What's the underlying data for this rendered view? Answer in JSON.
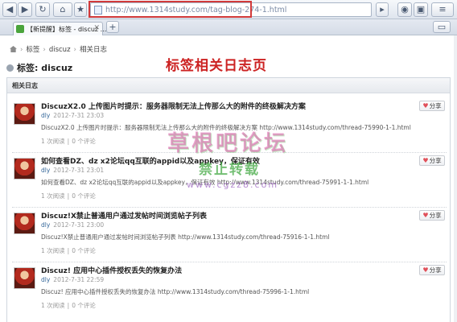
{
  "browser": {
    "back_icon": "arrow-left-icon",
    "forward_icon": "arrow-right-icon",
    "refresh_icon": "refresh-icon",
    "home_icon": "home-icon",
    "star_icon": "star-icon",
    "url": "http://www.1314study.com/tag-blog-274-1.html",
    "tab_title": "【新提醒】标签 - discuz ...",
    "new_tab_icon": "plus-icon"
  },
  "page": {
    "breadcrumb": [
      "标签",
      "discuz",
      "相关日志"
    ],
    "tag_title": "标签: discuz",
    "annotation": "标签相关日志页",
    "panel_title": "相关日志",
    "share_label": "分享",
    "posts": [
      {
        "title": "DiscuzX2.0 上传图片时提示：服务器限制无法上传那么大的附件的终极解决方案",
        "author": "dly",
        "date": "2012-7-31 23:03",
        "body": "DiscuzX2.0 上传图片时提示：服务器限制无法上传那么大的附件的终极解决方案 http://www.1314study.com/thread-75990-1-1.html",
        "views": "1 次阅读",
        "comments": "0 个评论"
      },
      {
        "title": "如何查看DZ、dz x2论坛qq互联的appid以及appkey，保证有效",
        "author": "dly",
        "date": "2012-7-31 23:01",
        "body": "如何查看DZ、dz x2论坛qq互联的appid以及appkey，保证有效 http://www.1314study.com/thread-75991-1-1.html",
        "views": "1 次阅读",
        "comments": "0 个评论"
      },
      {
        "title": "Discuz!X禁止普通用户通过发帖时间浏览帖子列表",
        "author": "dly",
        "date": "2012-7-31 23:00",
        "body": "Discuz!X禁止普通用户通过发帖时间浏览帖子列表 http://www.1314study.com/thread-75916-1-1.html",
        "views": "1 次阅读",
        "comments": "0 个评论"
      },
      {
        "title": "Discuz! 应用中心插件授权丢失的恢复办法",
        "author": "dly",
        "date": "2012-7-31 22:59",
        "body": "Discuz! 应用中心插件授权丢失的恢复办法 http://www.1314study.com/thread-75996-1-1.html",
        "views": "1 次阅读",
        "comments": "0 个评论"
      }
    ]
  },
  "watermark": {
    "line1": "草根吧论坛",
    "line2": "禁止转载",
    "line3": "www.cgzz8.com"
  }
}
